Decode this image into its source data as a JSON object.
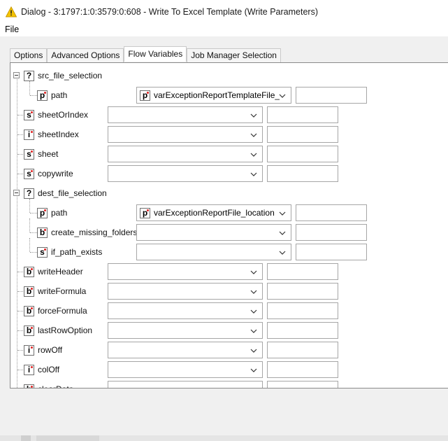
{
  "window": {
    "title": "Dialog - 3:1797:1:0:3579:0:608 - Write To Excel Template (Write Parameters)"
  },
  "menu": {
    "file": "File"
  },
  "tabs": [
    "Options",
    "Advanced Options",
    "Flow Variables",
    "Job Manager Selection"
  ],
  "active_tab": "Flow Variables",
  "colors": {
    "accent_dot": "#dd2222",
    "warning": "#f5c400"
  },
  "tree": [
    {
      "label": "src_file_selection",
      "icon": "question-icon",
      "glyph": "?",
      "group": true
    },
    {
      "label": "path",
      "icon": "path-type-icon",
      "glyph": "p",
      "child": true,
      "value": "varExceptionReportTemplateFile_l..."
    },
    {
      "label": "sheetOrIndex",
      "icon": "string-type-icon",
      "glyph": "s",
      "value": ""
    },
    {
      "label": "sheetIndex",
      "icon": "integer-type-icon",
      "glyph": "i",
      "value": ""
    },
    {
      "label": "sheet",
      "icon": "string-type-icon",
      "glyph": "s",
      "value": ""
    },
    {
      "label": "copywrite",
      "icon": "string-type-icon",
      "glyph": "s",
      "value": ""
    },
    {
      "label": "dest_file_selection",
      "icon": "question-icon",
      "glyph": "?",
      "group": true
    },
    {
      "label": "path",
      "icon": "path-type-icon",
      "glyph": "p",
      "child": true,
      "value": "varExceptionReportFile_location"
    },
    {
      "label": "create_missing_folders",
      "icon": "boolean-type-icon",
      "glyph": "b",
      "child": true,
      "value": ""
    },
    {
      "label": "if_path_exists",
      "icon": "string-type-icon",
      "glyph": "s",
      "child": true,
      "value": ""
    },
    {
      "label": "writeHeader",
      "icon": "boolean-type-icon",
      "glyph": "b",
      "value": ""
    },
    {
      "label": "writeFormula",
      "icon": "boolean-type-icon",
      "glyph": "b",
      "value": ""
    },
    {
      "label": "forceFormula",
      "icon": "boolean-type-icon",
      "glyph": "b",
      "value": ""
    },
    {
      "label": "lastRowOption",
      "icon": "boolean-type-icon",
      "glyph": "b",
      "value": ""
    },
    {
      "label": "rowOff",
      "icon": "integer-type-icon",
      "glyph": "i",
      "value": ""
    },
    {
      "label": "colOff",
      "icon": "integer-type-icon",
      "glyph": "i",
      "value": ""
    },
    {
      "label": "clearData",
      "icon": "boolean-type-icon",
      "glyph": "b",
      "value": ""
    }
  ]
}
